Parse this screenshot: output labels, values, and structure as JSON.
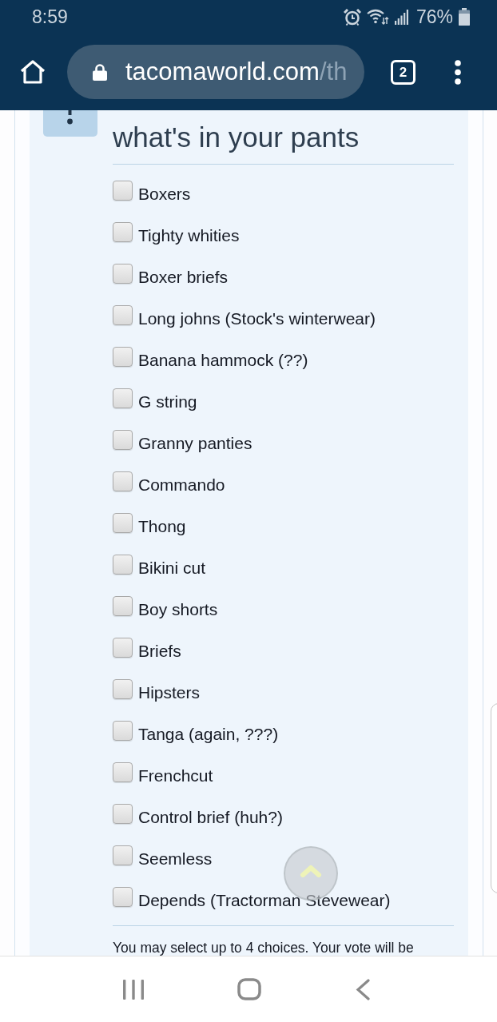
{
  "status_bar": {
    "time": "8:59",
    "battery": "76%"
  },
  "browser": {
    "url_domain": "tacomaworld.com",
    "url_path": "/th",
    "tab_count": "2"
  },
  "poll": {
    "title": "what's in your pants",
    "options": [
      {
        "label": "Boxers",
        "checked": false
      },
      {
        "label": "Tighty whities",
        "checked": false
      },
      {
        "label": "Boxer briefs",
        "checked": false
      },
      {
        "label": "Long johns (Stock's winterwear)",
        "checked": false
      },
      {
        "label": "Banana hammock (??)",
        "checked": false
      },
      {
        "label": "G string",
        "checked": false
      },
      {
        "label": "Granny panties",
        "checked": false
      },
      {
        "label": "Commando",
        "checked": false
      },
      {
        "label": "Thong",
        "checked": false
      },
      {
        "label": "Bikini cut",
        "checked": false
      },
      {
        "label": "Boy shorts",
        "checked": false
      },
      {
        "label": "Briefs",
        "checked": false
      },
      {
        "label": "Hipsters",
        "checked": false
      },
      {
        "label": "Tanga (again, ???)",
        "checked": false
      },
      {
        "label": "Frenchcut",
        "checked": false
      },
      {
        "label": "Control brief (huh?)",
        "checked": false
      },
      {
        "label": "Seemless",
        "checked": false
      },
      {
        "label": "Depends (Tractorman Stevewear)",
        "checked": false
      }
    ],
    "note": "You may select up to 4 choices. Your vote will be"
  }
}
